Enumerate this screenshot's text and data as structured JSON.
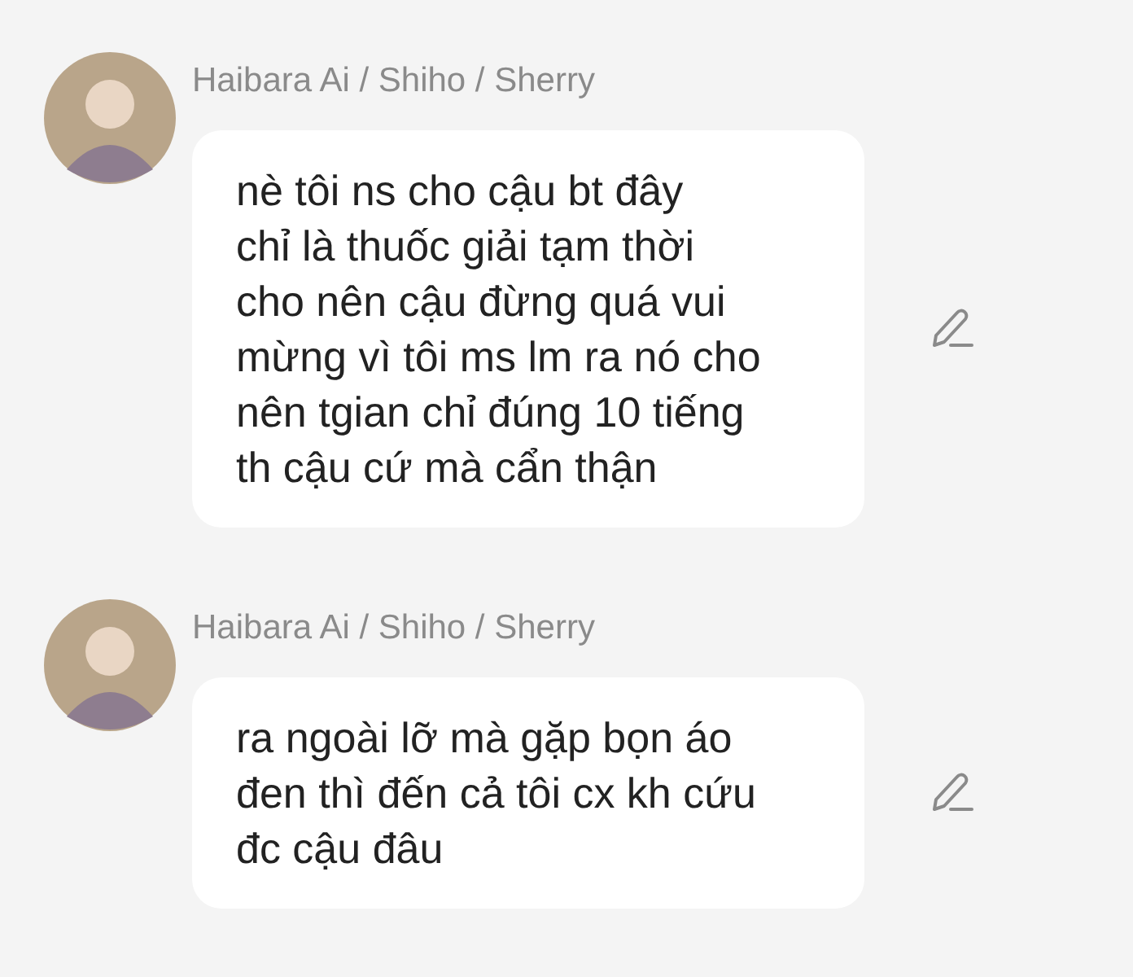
{
  "messages": [
    {
      "sender": "Haibara Ai / Shiho / Sherry",
      "text": "nè tôi ns cho cậu bt đây\nchỉ là thuốc giải tạm thời\ncho nên cậu đừng quá vui\nmừng vì tôi ms lm ra nó cho\nnên tgian chỉ đúng 10 tiếng\nth cậu cứ mà cẩn thận"
    },
    {
      "sender": "Haibara Ai / Shiho / Sherry",
      "text": "ra ngoài lỡ mà gặp bọn áo\nđen thì đến cả tôi cx kh cứu\nđc cậu đâu"
    }
  ]
}
